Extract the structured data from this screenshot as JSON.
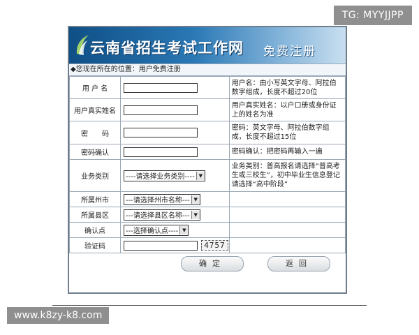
{
  "watermark_top": "TG: MYYJJPP",
  "watermark_bottom": "www.k8zy-k8.com",
  "header": {
    "site_title": "云南省招生考试工作网",
    "page_title": "免费注册"
  },
  "breadcrumb": "◆您现在所在的位置：用户免费注册",
  "form": {
    "username_label": "用 户 名",
    "username_hint": "用户名：由小写英文字母、阿拉伯数字组成，长度不超过20位",
    "realname_label": "用户真实姓名",
    "realname_hint": "用户真实姓名：以户口册或身份证上的姓名为准",
    "password_label": "密　　码",
    "password_hint": "密码：英文字母、阿拉伯数字组成，长度不超过15位",
    "confirm_label": "密码确认",
    "confirm_hint": "密码确认：把密码再输入一遍",
    "category_label": "业务类别",
    "category_select": "----请选择业务类别----",
    "category_hint": "业务类别：普高报名请选择“普高考生或三校生”，初中毕业生信息登记请选择“高中阶段”",
    "prefecture_label": "所属州市",
    "prefecture_select": "---请选择州市名称---",
    "county_label": "所属县区",
    "county_select": "---请选择县区名称---",
    "point_label": "确认点",
    "point_select": "---选择确认点----",
    "captcha_label": "验证码",
    "captcha_value": "4757"
  },
  "buttons": {
    "confirm": "确定",
    "back": "返回"
  }
}
